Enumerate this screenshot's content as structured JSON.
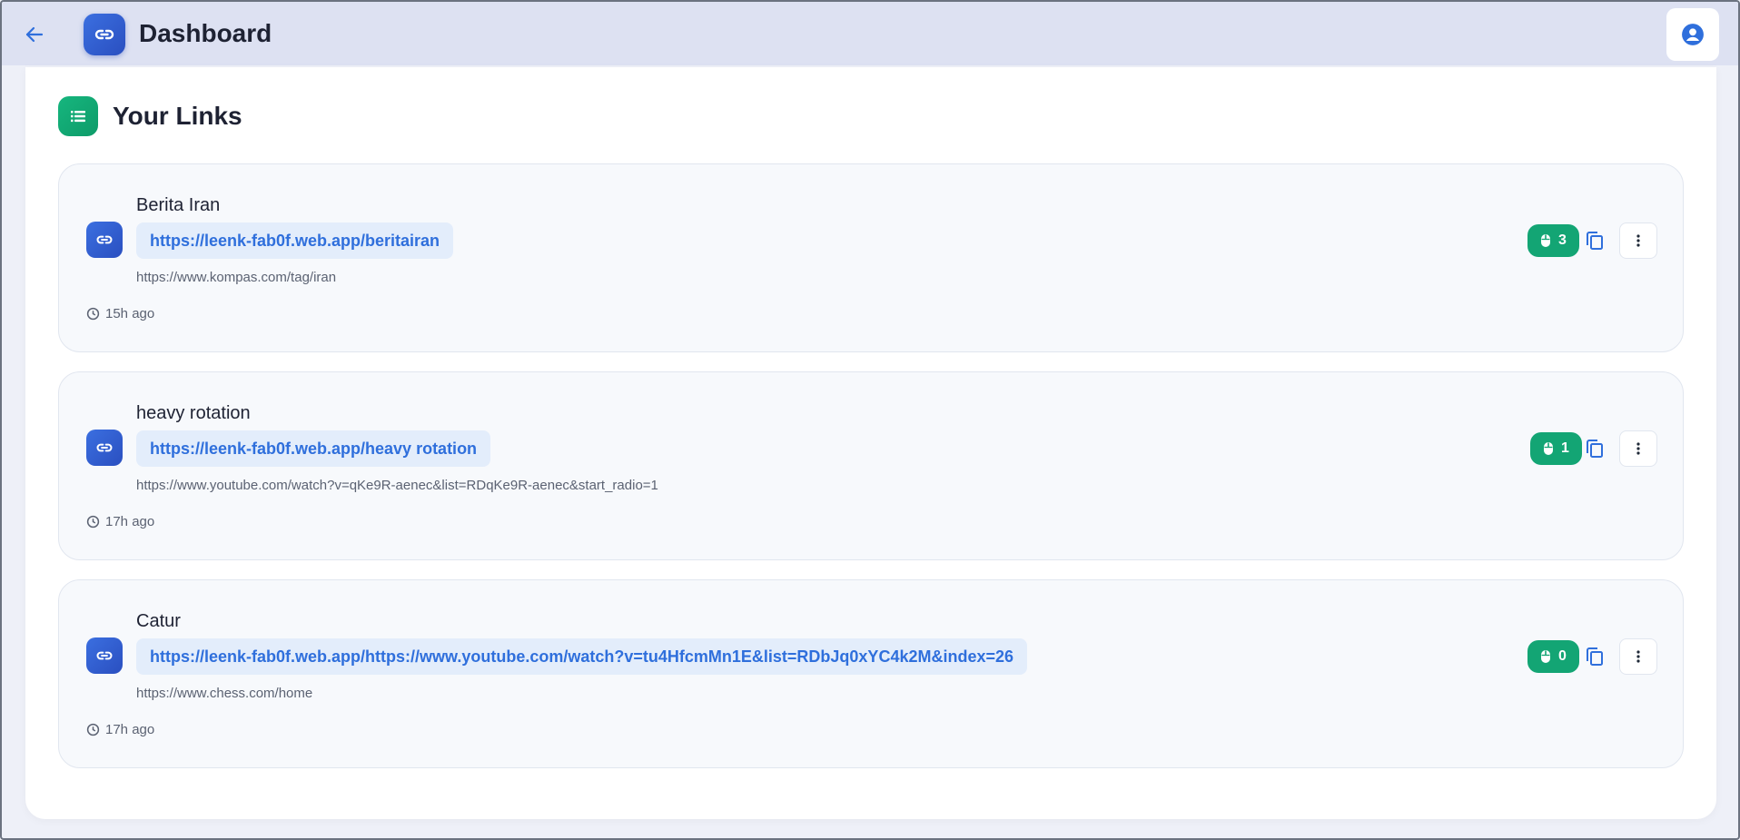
{
  "header": {
    "title": "Dashboard",
    "back_icon": "arrow-left-icon",
    "logo_icon": "link-icon",
    "avatar_icon": "user-circle-icon"
  },
  "section": {
    "title": "Your Links",
    "icon": "list-icon"
  },
  "links": [
    {
      "title": "Berita Iran",
      "short_url": "https://leenk-fab0f.web.app/beritairan",
      "original_url": "https://www.kompas.com/tag/iran",
      "time": "15h ago",
      "clicks": "3"
    },
    {
      "title": "heavy rotation",
      "short_url": "https://leenk-fab0f.web.app/heavy rotation",
      "original_url": "https://www.youtube.com/watch?v=qKe9R-aenec&list=RDqKe9R-aenec&start_radio=1",
      "time": "17h ago",
      "clicks": "1"
    },
    {
      "title": "Catur",
      "short_url": "https://leenk-fab0f.web.app/https://www.youtube.com/watch?v=tu4HfcmMn1E&list=RDbJq0xYC4k2M&index=26",
      "original_url": "https://www.chess.com/home",
      "time": "17h ago",
      "clicks": "0"
    }
  ],
  "colors": {
    "accent_blue": "#2f6fdc",
    "accent_green": "#13a574",
    "header_bg": "#dde1f2"
  }
}
